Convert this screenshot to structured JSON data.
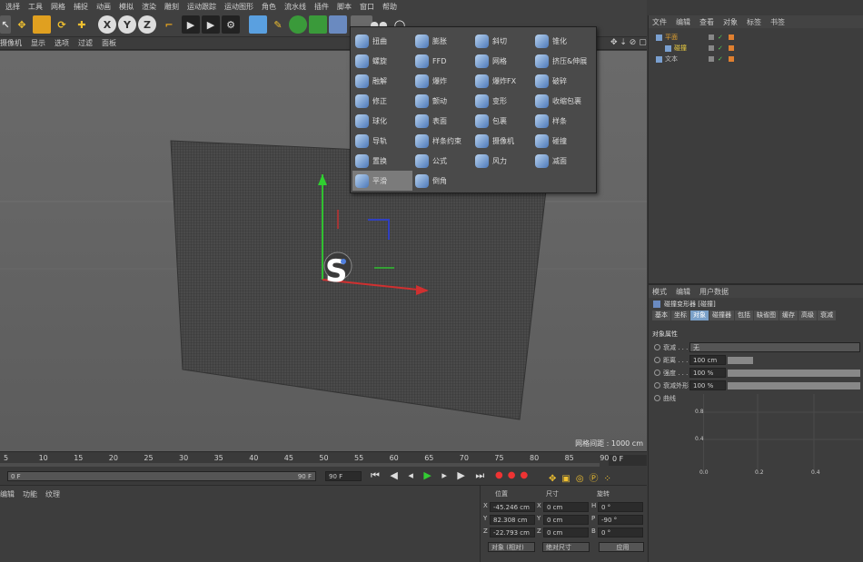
{
  "menubar": [
    "选择",
    "工具",
    "网格",
    "捕捉",
    "动画",
    "模拟",
    "渲染",
    "雕刻",
    "运动跟踪",
    "运动图形",
    "角色",
    "流水线",
    "插件",
    "脚本",
    "窗口",
    "帮助"
  ],
  "viewport_menu": [
    "摄像机",
    "显示",
    "选项",
    "过滤",
    "面板"
  ],
  "viewport": {
    "grid_info": "网格间距 : 1000 cm"
  },
  "deformer_menu": {
    "col1": [
      "扭曲",
      "螺旋",
      "融解",
      "修正",
      "球化",
      "导轨",
      "置换",
      "平滑"
    ],
    "col2": [
      "膨胀",
      "FFD",
      "爆炸",
      "颤动",
      "表面",
      "样条约束",
      "公式",
      "倒角"
    ],
    "col3": [
      "斜切",
      "网格",
      "爆炸FX",
      "变形",
      "包裹",
      "摄像机",
      "风力"
    ],
    "col4": [
      "锥化",
      "挤压&伸展",
      "破碎",
      "收缩包裹",
      "样条",
      "碰撞",
      "减面"
    ],
    "active": "平滑"
  },
  "timeline": {
    "ticks": [
      "5",
      "10",
      "15",
      "20",
      "25",
      "30",
      "35",
      "40",
      "45",
      "50",
      "55",
      "60",
      "65",
      "70",
      "75",
      "80",
      "85",
      "90"
    ],
    "current_frame": "0 F"
  },
  "transport": {
    "start_frame": "0 F",
    "range_end": "90 F",
    "end_frame": "90 F"
  },
  "material_panel": {
    "tabs": [
      "编辑",
      "功能",
      "纹理"
    ]
  },
  "coordinates": {
    "headers": [
      "位置",
      "尺寸",
      "旋转"
    ],
    "rows": [
      {
        "axis": "X",
        "pos": "-45.246 cm",
        "size_axis": "X",
        "size": "0 cm",
        "rot_axis": "H",
        "rot": "0 °"
      },
      {
        "axis": "Y",
        "pos": "82.308 cm",
        "size_axis": "Y",
        "size": "0 cm",
        "rot_axis": "P",
        "rot": "-90 °"
      },
      {
        "axis": "Z",
        "pos": "-22.793 cm",
        "size_axis": "Z",
        "size": "0 cm",
        "rot_axis": "B",
        "rot": "0 °"
      }
    ],
    "mode": "对象 (相对)",
    "size_mode": "绝对尺寸",
    "apply": "应用"
  },
  "object_manager": {
    "menu": [
      "文件",
      "编辑",
      "查看",
      "对象",
      "标签",
      "书签"
    ],
    "objects": [
      {
        "name": "平面",
        "color": "#e0a030"
      },
      {
        "name": "碰撞",
        "color": "#f0d040"
      },
      {
        "name": "文本",
        "color": "#c0c0c0"
      }
    ]
  },
  "attribute_manager": {
    "menu": [
      "模式",
      "编辑",
      "用户数据"
    ],
    "title": "碰撞变形器 [碰撞]",
    "tabs": [
      "基本",
      "坐标",
      "对象",
      "碰撞器",
      "包括",
      "缺省图",
      "缓存",
      "高级",
      "衰减"
    ],
    "active_tab": "对象",
    "section": "对象属性",
    "fields": [
      {
        "label": "衰减 . . . . . .",
        "value": "无"
      },
      {
        "label": "距离 . . . . . .",
        "value": "100 cm"
      },
      {
        "label": "强度 . . . . . .",
        "value": "100 %"
      },
      {
        "label": "衰减外形",
        "value": "100 %"
      },
      {
        "label": "曲线",
        "value": ""
      }
    ],
    "graph": {
      "y_ticks": [
        "0.8",
        "0.4"
      ],
      "x_ticks": [
        "0.0",
        "0.2",
        "0.4"
      ]
    }
  }
}
